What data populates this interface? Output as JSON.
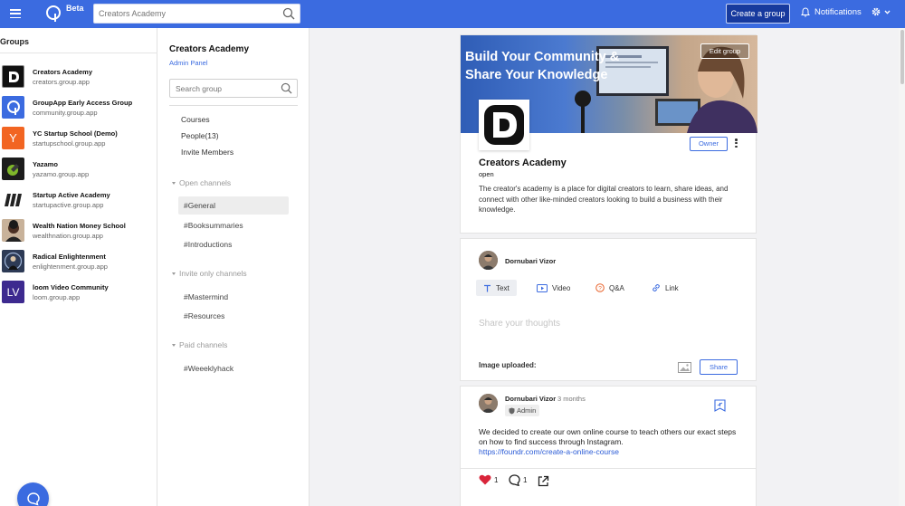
{
  "topbar": {
    "beta": "Beta",
    "search_placeholder": "Creators Academy",
    "create_group": "Create a group",
    "notifications": "Notifications",
    "accent": "#3b6be0"
  },
  "sidebar": {
    "title": "Groups",
    "groups": [
      {
        "name": "Creators Academy",
        "domain": "creators.group.app",
        "avatar": "d-logo",
        "bg": "#111111"
      },
      {
        "name": "GroupApp Early Access Group",
        "domain": "community.group.app",
        "avatar": "groupapp-logo",
        "bg": "#3b6be0"
      },
      {
        "name": "YC Startup School (Demo)",
        "domain": "startupschool.group.app",
        "avatar": "Y",
        "bg": "#f26522"
      },
      {
        "name": "Yazamo",
        "domain": "yazamo.group.app",
        "avatar": "yazamo-logo",
        "bg": "#1c1c1c"
      },
      {
        "name": "Startup Active Academy",
        "domain": "startupactive.group.app",
        "avatar": "stripes-logo",
        "bg": "#ffffff"
      },
      {
        "name": "Wealth Nation Money School",
        "domain": "wealthnation.group.app",
        "avatar": "person-photo",
        "bg": "#b69a80"
      },
      {
        "name": "Radical Enlightenment",
        "domain": "enlightenment.group.app",
        "avatar": "person-photo",
        "bg": "#2d3a55"
      },
      {
        "name": "loom Video Community",
        "domain": "loom.group.app",
        "avatar": "LV",
        "bg": "#3d2a8f"
      }
    ]
  },
  "midnav": {
    "group_title": "Creators Academy",
    "admin_panel": "Admin Panel",
    "search_placeholder": "Search group",
    "links": [
      "Courses",
      "People(13)",
      "Invite Members"
    ],
    "open_channels_label": "Open channels",
    "open_channels": [
      "#General",
      "#Booksummaries",
      "#Introductions"
    ],
    "invite_channels_label": "Invite only channels",
    "invite_channels": [
      "#Mastermind",
      "#Resources"
    ],
    "paid_channels_label": "Paid channels",
    "paid_channels": [
      "#Weeeklyhack"
    ]
  },
  "group_card": {
    "cover_title": "Build Your Community & Share Your Knowledge",
    "edit_group": "Edit group",
    "owner": "Owner",
    "name": "Creators Academy",
    "status": "open",
    "description": "The creator's academy is a place for digital creators to learn, share ideas, and connect with other like-minded creators looking to build a business with their knowledge."
  },
  "composer": {
    "author": "Dornubari Vizor",
    "tabs": [
      "Text",
      "Video",
      "Q&A",
      "Link"
    ],
    "placeholder": "Share your thoughts",
    "image_uploaded": "Image uploaded:",
    "share": "Share"
  },
  "post": {
    "author": "Dornubari Vizor",
    "time": "3 months",
    "badge": "Admin",
    "text": "We decided to create our own online course to teach others our exact steps on how to find success through Instagram.",
    "link": "https://foundr.com/create-a-online-course",
    "likes": "1",
    "comments": "1"
  }
}
